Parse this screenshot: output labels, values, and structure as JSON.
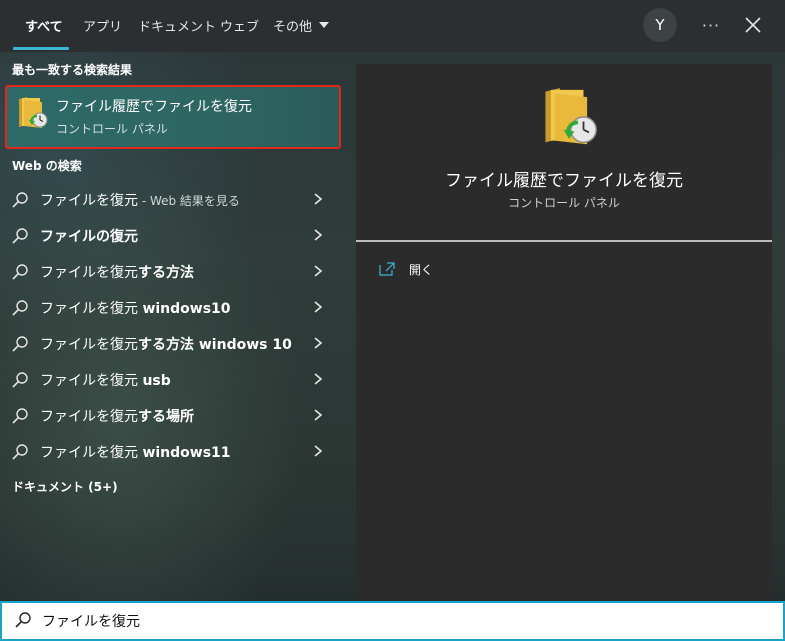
{
  "tabs": [
    {
      "label": "すべて",
      "active": true
    },
    {
      "label": "アプリ"
    },
    {
      "label": "ドキュメント"
    },
    {
      "label": "ウェブ"
    },
    {
      "label": "その他"
    }
  ],
  "header": {
    "avatar_letter": "Y",
    "more_label": "···"
  },
  "best_match": {
    "section_label": "最も一致する検索結果",
    "title": "ファイル履歴でファイルを復元",
    "subtitle": "コントロール パネル",
    "icon": "file-history-folder-icon"
  },
  "web": {
    "section_label": "Web の検索",
    "suggestions": [
      {
        "plain": "ファイルを復元",
        "bold": "",
        "extra": " - Web 結果を見る"
      },
      {
        "plain": "",
        "bold": "ファイルの復元",
        "extra": ""
      },
      {
        "plain": "ファイルを復元",
        "bold": "する方法",
        "extra": ""
      },
      {
        "plain": "ファイルを復元 ",
        "bold": "windows10",
        "extra": ""
      },
      {
        "plain": "ファイルを復元",
        "bold": "する方法 windows 10",
        "extra": ""
      },
      {
        "plain": "ファイルを復元 ",
        "bold": "usb",
        "extra": ""
      },
      {
        "plain": "ファイルを復元",
        "bold": "する場所",
        "extra": ""
      },
      {
        "plain": "ファイルを復元 ",
        "bold": "windows11",
        "extra": ""
      }
    ]
  },
  "documents": {
    "section_label": "ドキュメント (5+)"
  },
  "preview": {
    "title": "ファイル履歴でファイルを復元",
    "subtitle": "コントロール パネル",
    "open_label": "開く"
  },
  "search": {
    "value": "ファイルを復元"
  },
  "colors": {
    "accent": "#3fb5d6",
    "highlight_border": "#e0291d",
    "selected_bg": "#2d6a67"
  }
}
